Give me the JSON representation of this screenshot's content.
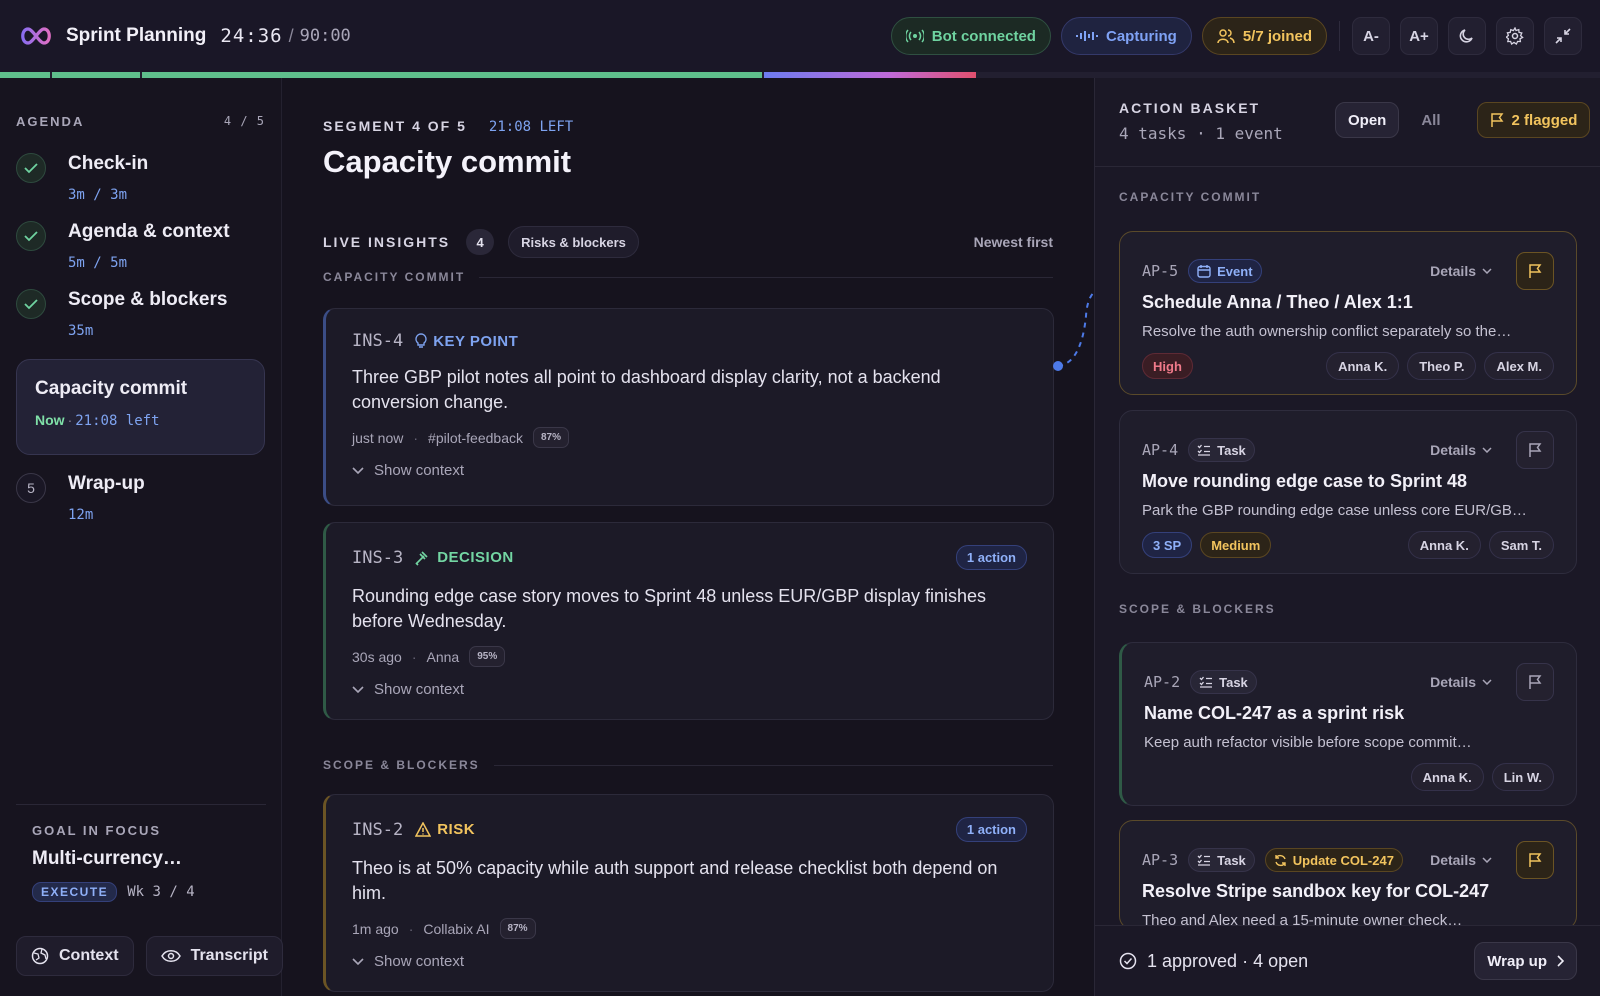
{
  "header": {
    "title": "Sprint Planning",
    "timer_elapsed": "24:36",
    "timer_sep": "/",
    "timer_total": "90:00",
    "bot_status": "Bot connected",
    "capture_status": "Capturing",
    "joined": "5/7 joined",
    "font_down": "A-",
    "font_up": "A+",
    "icons": [
      "infinity-logo",
      "radio-icon",
      "waveform-icon",
      "users-icon",
      "moon-icon",
      "gear-icon",
      "collapse-icon"
    ]
  },
  "progress": {
    "segments_done": 3,
    "current_segment": 4,
    "segments_total": 5
  },
  "sidebar": {
    "heading": "AGENDA",
    "count": "4 / 5",
    "items": [
      {
        "label": "Check-in",
        "time": "3m / 3m",
        "state": "done"
      },
      {
        "label": "Agenda & context",
        "time": "5m / 5m",
        "state": "done"
      },
      {
        "label": "Scope & blockers",
        "time": "35m",
        "state": "done"
      },
      {
        "label": "Capacity commit",
        "now": "Now",
        "dot": "·",
        "left": "21:08 left",
        "state": "active"
      },
      {
        "label": "Wrap-up",
        "time": "12m",
        "number": "5",
        "state": "upcoming"
      }
    ],
    "goal": {
      "label": "GOAL IN FOCUS",
      "title": "Multi-currency…",
      "badge": "EXECUTE",
      "week": "Wk 3 / 4"
    },
    "buttons": {
      "context": "Context",
      "transcript": "Transcript"
    }
  },
  "main": {
    "segment_label": "SEGMENT 4 OF 5",
    "segment_left": "21:08 LEFT",
    "title": "Capacity commit",
    "insights_label": "LIVE INSIGHTS",
    "insights_count": "4",
    "filter": "Risks & blockers",
    "sort": "Newest first",
    "section_1": "CAPACITY COMMIT",
    "section_2": "SCOPE & BLOCKERS",
    "show_context": "Show context",
    "cards": [
      {
        "id": "INS-4",
        "type": "KEY POINT",
        "body": "Three GBP pilot notes all point to dashboard display clarity, not a backend conversion change.",
        "time": "just now",
        "source": "#pilot-feedback",
        "confidence": "87%"
      },
      {
        "id": "INS-3",
        "type": "DECISION",
        "action": "1 action",
        "body": "Rounding edge case story moves to Sprint 48 unless EUR/GBP display finishes before Wednesday.",
        "time": "30s ago",
        "source": "Anna",
        "confidence": "95%"
      },
      {
        "id": "INS-2",
        "type": "RISK",
        "action": "1 action",
        "body": "Theo is at 50% capacity while auth support and release checklist both depend on him.",
        "time": "1m ago",
        "source": "Collabix AI",
        "confidence": "87%"
      }
    ],
    "meta_dot": "·"
  },
  "basket": {
    "title": "ACTION BASKET",
    "subtitle": "4 tasks · 1 event",
    "tab_open": "Open",
    "tab_all": "All",
    "flagged": "2 flagged",
    "section_1": "CAPACITY COMMIT",
    "section_2": "SCOPE & BLOCKERS",
    "details": "Details",
    "items": [
      {
        "id": "AP-5",
        "kind": "Event",
        "title": "Schedule Anna / Theo / Alex 1:1",
        "desc": "Resolve the auth ownership conflict separately so the…",
        "priority": "High",
        "people": [
          "Anna K.",
          "Theo P.",
          "Alex M."
        ],
        "flagged": true
      },
      {
        "id": "AP-4",
        "kind": "Task",
        "title": "Move rounding edge case to Sprint 48",
        "desc": "Park the GBP rounding edge case unless core EUR/GB…",
        "points": "3 SP",
        "priority": "Medium",
        "people": [
          "Anna K.",
          "Sam T."
        ],
        "flagged": false
      },
      {
        "id": "AP-2",
        "kind": "Task",
        "title": "Name COL-247 as a sprint risk",
        "desc": "Keep auth refactor visible before scope commit…",
        "people": [
          "Anna K.",
          "Lin W."
        ],
        "flagged": false
      },
      {
        "id": "AP-3",
        "kind": "Task",
        "update": "Update COL-247",
        "title": "Resolve Stripe sandbox key for COL-247",
        "desc": "Theo and Alex need a 15-minute owner check…",
        "flagged": true
      }
    ],
    "summary": "1 approved · 4 open",
    "wrap": "Wrap up"
  },
  "colors": {
    "accent_blue": "#7ea3f0",
    "accent_green": "#6fd3a0",
    "accent_amber": "#f2c45e",
    "danger": "#f07a8a"
  }
}
